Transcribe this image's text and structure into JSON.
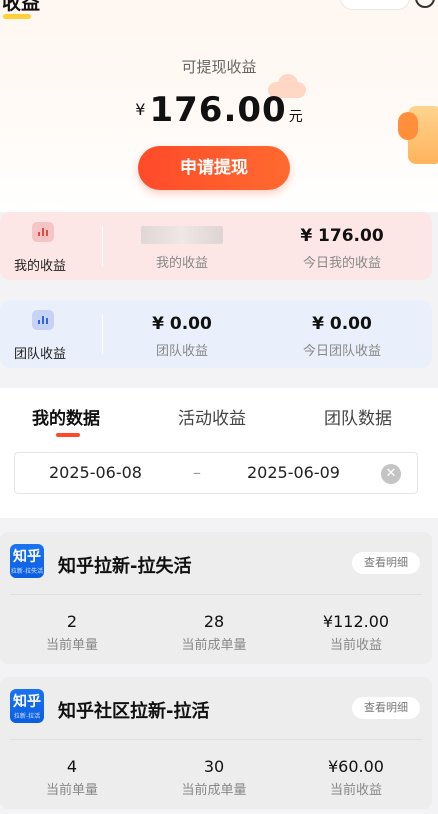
{
  "header": {
    "title": "收益"
  },
  "summary": {
    "label": "可提现收益",
    "currency": "¥",
    "amount": "176.00",
    "unit": "元",
    "withdraw_label": "申请提现"
  },
  "my_earnings": {
    "side_label": "我的收益",
    "col1_caption": "我的收益",
    "col2_value": "¥ 176.00",
    "col2_caption": "今日我的收益",
    "accent": "#e34a4a"
  },
  "team_earnings": {
    "side_label": "团队收益",
    "col1_value": "¥ 0.00",
    "col1_caption": "团队收益",
    "col2_value": "¥ 0.00",
    "col2_caption": "今日团队收益",
    "accent": "#3466d6"
  },
  "tabs": [
    {
      "label": "我的数据",
      "active": true
    },
    {
      "label": "活动收益",
      "active": false
    },
    {
      "label": "团队数据",
      "active": false
    }
  ],
  "date_range": {
    "start": "2025-06-08",
    "separator": "–",
    "end": "2025-06-09"
  },
  "tasks": [
    {
      "logo_text": "知乎",
      "logo_sub": "拉新-拉失活",
      "name": "知乎拉新-拉失活",
      "detail_label": "查看明细",
      "stats": [
        {
          "value": "2",
          "caption": "当前单量"
        },
        {
          "value": "28",
          "caption": "当前成单量"
        },
        {
          "value": "¥112.00",
          "caption": "当前收益"
        }
      ]
    },
    {
      "logo_text": "知乎",
      "logo_sub": "拉新-拉活",
      "name": "知乎社区拉新-拉活",
      "detail_label": "查看明细",
      "stats": [
        {
          "value": "4",
          "caption": "当前单量"
        },
        {
          "value": "30",
          "caption": "当前成单量"
        },
        {
          "value": "¥60.00",
          "caption": "当前收益"
        }
      ]
    }
  ],
  "colors": {
    "primary": "#ff4a2a",
    "brand_blue": "#1b73f2"
  }
}
